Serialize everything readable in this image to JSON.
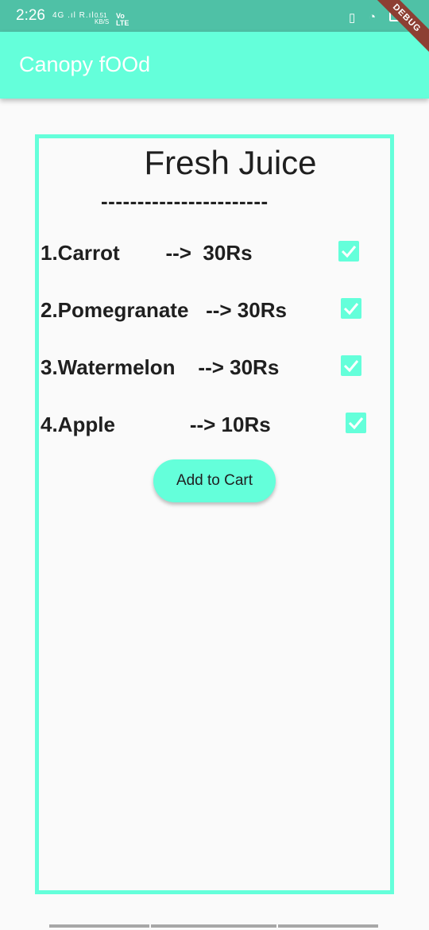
{
  "status_bar": {
    "time": "2:26",
    "network": "4G .ıl R.ıl",
    "speed": "0.51\nKB/S",
    "volte": "Vo\nLTE"
  },
  "debug_banner": "DEBUG",
  "app_bar": {
    "title": "Canopy fOOd"
  },
  "card": {
    "title": "Fresh Juice",
    "divider": "-----------------------",
    "items": [
      {
        "label": "1.Carrot        -->  30Rs",
        "checked": true
      },
      {
        "label": "2.Pomegranate   --> 30Rs",
        "checked": true
      },
      {
        "label": "3.Watermelon    --> 30Rs",
        "checked": true
      },
      {
        "label": "4.Apple             --> 10Rs",
        "checked": true
      }
    ],
    "button_label": "Add to Cart"
  },
  "colors": {
    "accent": "#64ffda",
    "status_bar": "#4fc1a6",
    "debug": "#8d3f33"
  }
}
